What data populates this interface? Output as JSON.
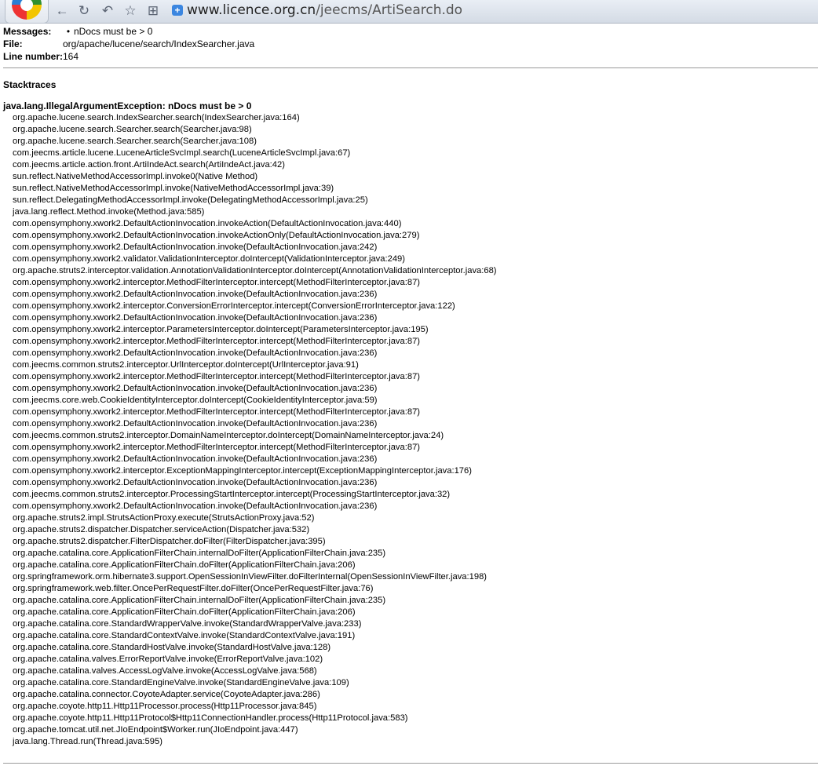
{
  "browser": {
    "address_host": "www.licence.org.cn",
    "address_path": "/jeecms/ArtiSearch.do"
  },
  "info": {
    "messages_label": "Messages:",
    "message_item": "nDocs must be > 0",
    "file_label": "File:",
    "file_value": "org/apache/lucene/search/IndexSearcher.java",
    "line_label": "Line number:",
    "line_value": "164"
  },
  "stacktraces": {
    "heading": "Stacktraces",
    "exception": "java.lang.IllegalArgumentException: nDocs must be > 0",
    "frames": [
      "org.apache.lucene.search.IndexSearcher.search(IndexSearcher.java:164)",
      "org.apache.lucene.search.Searcher.search(Searcher.java:98)",
      "org.apache.lucene.search.Searcher.search(Searcher.java:108)",
      "com.jeecms.article.lucene.LuceneArticleSvcImpl.search(LuceneArticleSvcImpl.java:67)",
      "com.jeecms.article.action.front.ArtiIndeAct.search(ArtiIndeAct.java:42)",
      "sun.reflect.NativeMethodAccessorImpl.invoke0(Native Method)",
      "sun.reflect.NativeMethodAccessorImpl.invoke(NativeMethodAccessorImpl.java:39)",
      "sun.reflect.DelegatingMethodAccessorImpl.invoke(DelegatingMethodAccessorImpl.java:25)",
      "java.lang.reflect.Method.invoke(Method.java:585)",
      "com.opensymphony.xwork2.DefaultActionInvocation.invokeAction(DefaultActionInvocation.java:440)",
      "com.opensymphony.xwork2.DefaultActionInvocation.invokeActionOnly(DefaultActionInvocation.java:279)",
      "com.opensymphony.xwork2.DefaultActionInvocation.invoke(DefaultActionInvocation.java:242)",
      "com.opensymphony.xwork2.validator.ValidationInterceptor.doIntercept(ValidationInterceptor.java:249)",
      "org.apache.struts2.interceptor.validation.AnnotationValidationInterceptor.doIntercept(AnnotationValidationInterceptor.java:68)",
      "com.opensymphony.xwork2.interceptor.MethodFilterInterceptor.intercept(MethodFilterInterceptor.java:87)",
      "com.opensymphony.xwork2.DefaultActionInvocation.invoke(DefaultActionInvocation.java:236)",
      "com.opensymphony.xwork2.interceptor.ConversionErrorInterceptor.intercept(ConversionErrorInterceptor.java:122)",
      "com.opensymphony.xwork2.DefaultActionInvocation.invoke(DefaultActionInvocation.java:236)",
      "com.opensymphony.xwork2.interceptor.ParametersInterceptor.doIntercept(ParametersInterceptor.java:195)",
      "com.opensymphony.xwork2.interceptor.MethodFilterInterceptor.intercept(MethodFilterInterceptor.java:87)",
      "com.opensymphony.xwork2.DefaultActionInvocation.invoke(DefaultActionInvocation.java:236)",
      "com.jeecms.common.struts2.interceptor.UrlInterceptor.doIntercept(UrlInterceptor.java:91)",
      "com.opensymphony.xwork2.interceptor.MethodFilterInterceptor.intercept(MethodFilterInterceptor.java:87)",
      "com.opensymphony.xwork2.DefaultActionInvocation.invoke(DefaultActionInvocation.java:236)",
      "com.jeecms.core.web.CookieIdentityInterceptor.doIntercept(CookieIdentityInterceptor.java:59)",
      "com.opensymphony.xwork2.interceptor.MethodFilterInterceptor.intercept(MethodFilterInterceptor.java:87)",
      "com.opensymphony.xwork2.DefaultActionInvocation.invoke(DefaultActionInvocation.java:236)",
      "com.jeecms.common.struts2.interceptor.DomainNameInterceptor.doIntercept(DomainNameInterceptor.java:24)",
      "com.opensymphony.xwork2.interceptor.MethodFilterInterceptor.intercept(MethodFilterInterceptor.java:87)",
      "com.opensymphony.xwork2.DefaultActionInvocation.invoke(DefaultActionInvocation.java:236)",
      "com.opensymphony.xwork2.interceptor.ExceptionMappingInterceptor.intercept(ExceptionMappingInterceptor.java:176)",
      "com.opensymphony.xwork2.DefaultActionInvocation.invoke(DefaultActionInvocation.java:236)",
      "com.jeecms.common.struts2.interceptor.ProcessingStartInterceptor.intercept(ProcessingStartInterceptor.java:32)",
      "com.opensymphony.xwork2.DefaultActionInvocation.invoke(DefaultActionInvocation.java:236)",
      "org.apache.struts2.impl.StrutsActionProxy.execute(StrutsActionProxy.java:52)",
      "org.apache.struts2.dispatcher.Dispatcher.serviceAction(Dispatcher.java:532)",
      "org.apache.struts2.dispatcher.FilterDispatcher.doFilter(FilterDispatcher.java:395)",
      "org.apache.catalina.core.ApplicationFilterChain.internalDoFilter(ApplicationFilterChain.java:235)",
      "org.apache.catalina.core.ApplicationFilterChain.doFilter(ApplicationFilterChain.java:206)",
      "org.springframework.orm.hibernate3.support.OpenSessionInViewFilter.doFilterInternal(OpenSessionInViewFilter.java:198)",
      "org.springframework.web.filter.OncePerRequestFilter.doFilter(OncePerRequestFilter.java:76)",
      "org.apache.catalina.core.ApplicationFilterChain.internalDoFilter(ApplicationFilterChain.java:235)",
      "org.apache.catalina.core.ApplicationFilterChain.doFilter(ApplicationFilterChain.java:206)",
      "org.apache.catalina.core.StandardWrapperValve.invoke(StandardWrapperValve.java:233)",
      "org.apache.catalina.core.StandardContextValve.invoke(StandardContextValve.java:191)",
      "org.apache.catalina.core.StandardHostValve.invoke(StandardHostValve.java:128)",
      "org.apache.catalina.valves.ErrorReportValve.invoke(ErrorReportValve.java:102)",
      "org.apache.catalina.valves.AccessLogValve.invoke(AccessLogValve.java:568)",
      "org.apache.catalina.core.StandardEngineValve.invoke(StandardEngineValve.java:109)",
      "org.apache.catalina.connector.CoyoteAdapter.service(CoyoteAdapter.java:286)",
      "org.apache.coyote.http11.Http11Processor.process(Http11Processor.java:845)",
      "org.apache.coyote.http11.Http11Protocol$Http11ConnectionHandler.process(Http11Protocol.java:583)",
      "org.apache.tomcat.util.net.JIoEndpoint$Worker.run(JIoEndpoint.java:447)",
      "java.lang.Thread.run(Thread.java:595)"
    ]
  }
}
